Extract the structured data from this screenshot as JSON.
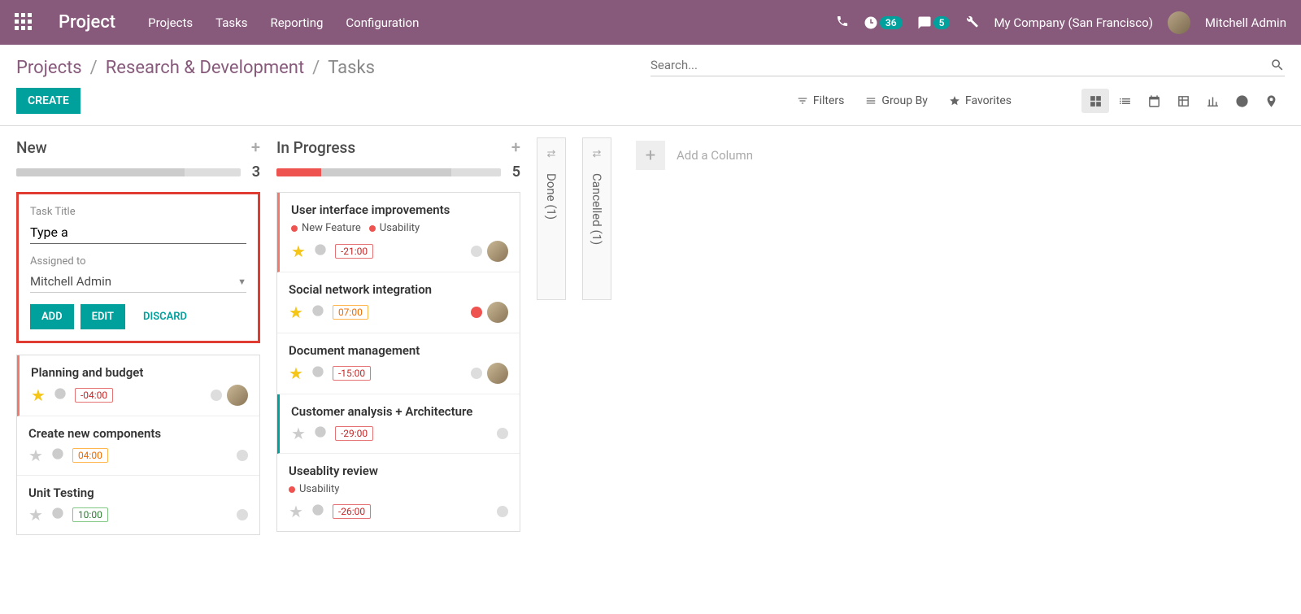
{
  "brand": "Project",
  "nav": [
    "Projects",
    "Tasks",
    "Reporting",
    "Configuration"
  ],
  "top": {
    "clock_badge": "36",
    "chat_badge": "5",
    "company": "My Company (San Francisco)",
    "user": "Mitchell Admin"
  },
  "breadcrumb": {
    "a": "Projects",
    "b": "Research & Development",
    "c": "Tasks"
  },
  "search_placeholder": "Search...",
  "create_label": "CREATE",
  "filters": {
    "filters": "Filters",
    "groupby": "Group By",
    "favorites": "Favorites"
  },
  "quick": {
    "title_label": "Task Title",
    "title_value": "Type a",
    "assigned_label": "Assigned to",
    "assigned_value": "Mitchell Admin",
    "add": "ADD",
    "edit": "EDIT",
    "discard": "DISCARD"
  },
  "cols": {
    "new": {
      "title": "New",
      "count": "3"
    },
    "inprog": {
      "title": "In Progress",
      "count": "5"
    },
    "done": {
      "title": "Done (1)"
    },
    "cancelled": {
      "title": "Cancelled (1)"
    }
  },
  "cards_new": [
    {
      "title": "Planning and budget",
      "time": "-04:00",
      "tb": "tb-red",
      "star": true,
      "avatar": true,
      "stripe": "stripe-red"
    },
    {
      "title": "Create new components",
      "time": "04:00",
      "tb": "tb-orange",
      "star": false
    },
    {
      "title": "Unit Testing",
      "time": "10:00",
      "tb": "tb-green",
      "star": false
    }
  ],
  "cards_ip": [
    {
      "title": "User interface improvements",
      "tags": [
        "New Feature",
        "Usability"
      ],
      "time": "-21:00",
      "tb": "tb-red",
      "star": true,
      "avatar": true,
      "stripe": "stripe-red"
    },
    {
      "title": "Social network integration",
      "time": "07:00",
      "tb": "tb-orange",
      "star": true,
      "avatar": true,
      "status": "red"
    },
    {
      "title": "Document management",
      "time": "-15:00",
      "tb": "tb-red",
      "star": true,
      "avatar": true
    },
    {
      "title": "Customer analysis + Architecture",
      "time": "-29:00",
      "tb": "tb-red",
      "star": false,
      "stripe": "stripe-teal"
    },
    {
      "title": "Useablity review",
      "tags": [
        "Usability"
      ],
      "time": "-26:00",
      "tb": "tb-red",
      "star": false
    }
  ],
  "add_column_label": "Add a Column"
}
